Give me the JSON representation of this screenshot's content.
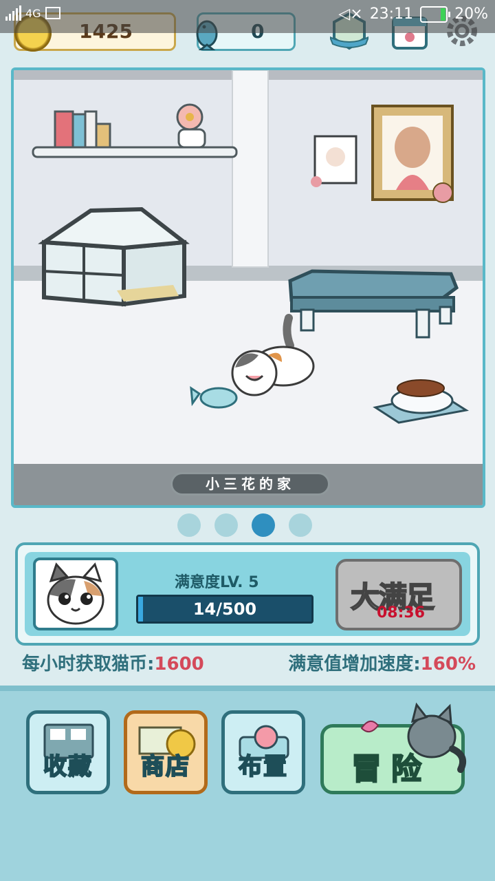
{
  "status_bar": {
    "network": "4G",
    "sim": "2",
    "time": "23:11",
    "battery": "20%",
    "icons": [
      "signal-icon",
      "image-icon",
      "mute-icon",
      "battery-icon"
    ]
  },
  "hud": {
    "coins": "1425",
    "fish": "0",
    "icons": [
      "paw-coin-icon",
      "fish-icon",
      "badge-icon",
      "calendar-icon",
      "gear-icon"
    ]
  },
  "room": {
    "name": "小三花的家"
  },
  "pager": {
    "pages": 4,
    "active": 3
  },
  "panel": {
    "level_label": "满意度LV. 5",
    "progress_text": "14/500",
    "progress_fraction": 0.028,
    "button_label": "大满足",
    "timer": "08:36"
  },
  "stats": {
    "coins_label": "每小时获取猫币:",
    "coins_value": "1600",
    "speed_label": "满意值增加速度:",
    "speed_value": "160%"
  },
  "nav": {
    "collection": "收藏",
    "shop": "商店",
    "decorate": "布置",
    "adventure": "冒险"
  },
  "colors": {
    "accent": "#4fa6b4",
    "progress_fill": "#39a8e0",
    "stat_value": "#d44a5a",
    "timer": "#c8102e"
  }
}
